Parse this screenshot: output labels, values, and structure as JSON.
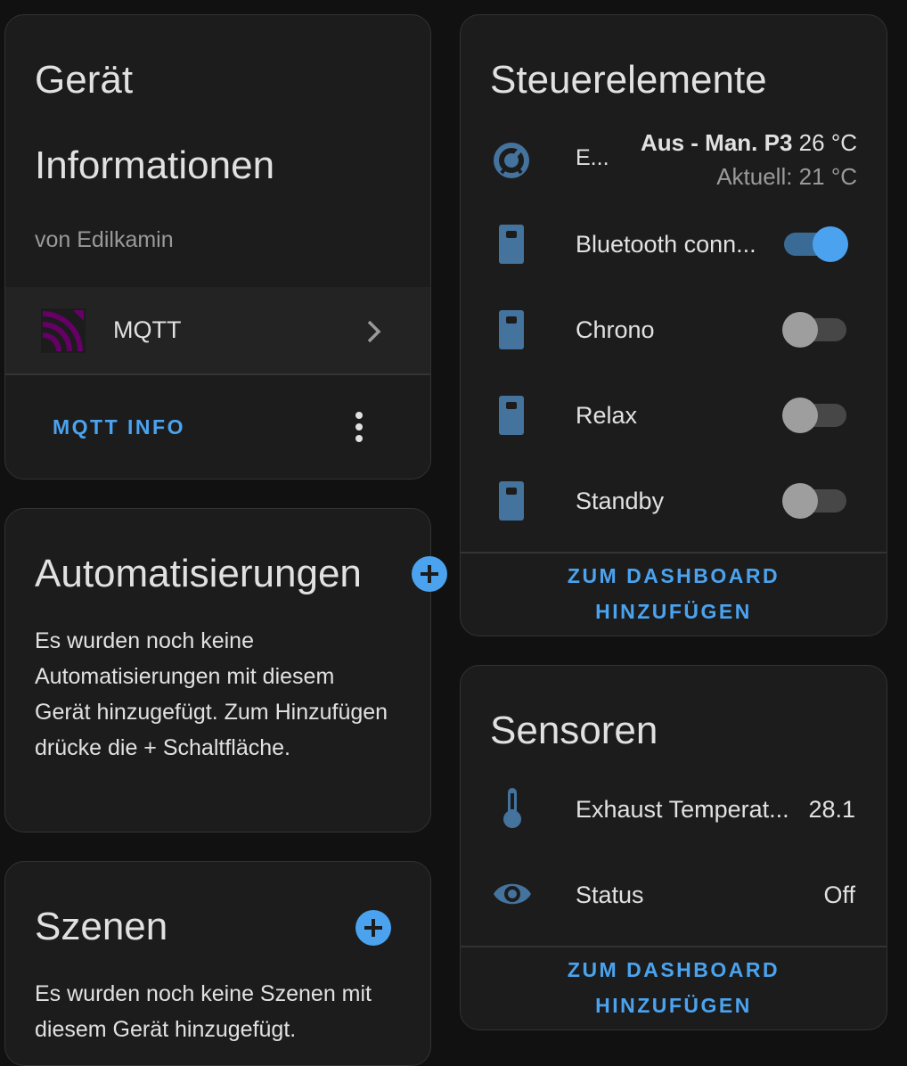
{
  "device_card": {
    "title_line1": "Gerät",
    "title_line2": "Informationen",
    "manufacturer": "von Edilkamin",
    "integration": {
      "icon": "mqtt-icon",
      "label": "MQTT"
    },
    "action_label": "MQTT INFO"
  },
  "automations_card": {
    "title": "Automatisierungen",
    "text": "Es wurden noch keine Automatisierungen mit diesem Gerät hinzugefügt. Zum Hinzufügen drücke die + Schaltfläche."
  },
  "scenes_card": {
    "title": "Szenen",
    "text": "Es wurden noch keine Szenen mit diesem Gerät hinzugefügt."
  },
  "controls_card": {
    "title": "Steuerelemente",
    "climate": {
      "icon": "thermostat-icon",
      "name": "E...",
      "state_mode": "Aus - Man. P3",
      "target": "26 °C",
      "current": "Aktuell: 21 °C"
    },
    "switches": [
      {
        "icon": "switch-icon",
        "label": "Bluetooth conn...",
        "on": true
      },
      {
        "icon": "switch-icon",
        "label": "Chrono",
        "on": false
      },
      {
        "icon": "switch-icon",
        "label": "Relax",
        "on": false
      },
      {
        "icon": "switch-icon",
        "label": "Standby",
        "on": false
      }
    ],
    "action_line1": "ZUM DASHBOARD",
    "action_line2": "HINZUFÜGEN"
  },
  "sensors_card": {
    "title": "Sensoren",
    "rows": [
      {
        "icon": "thermometer-icon",
        "label": "Exhaust Temperat...",
        "value": "28.1"
      },
      {
        "icon": "eye-icon",
        "label": "Status",
        "value": "Off"
      }
    ],
    "action_line1": "ZUM DASHBOARD",
    "action_line2": "HINZUFÜGEN"
  },
  "colors": {
    "accent": "#4ba3ef",
    "icon": "#44739e",
    "card_bg": "#1c1c1c",
    "page_bg": "#111111",
    "mqtt_purple": "#660066"
  }
}
